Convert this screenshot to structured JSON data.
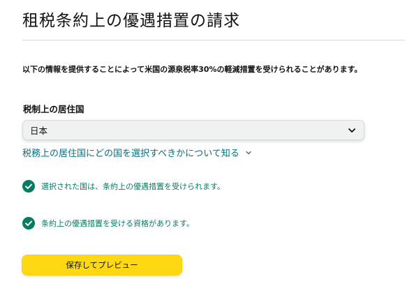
{
  "header": {
    "title": "租税条約上の優遇措置の請求"
  },
  "intro_text": "以下の情報を提供することによって米国の源泉税率30%の軽減措置を受けられることがあります。",
  "residence": {
    "label": "税制上の居住国",
    "selected_value": "日本",
    "dropdown_icon": "chevron-down-icon"
  },
  "learn_more": {
    "label": "税務上の居住国にどの国を選択すべきかについて知る",
    "icon": "chevron-down-icon"
  },
  "statuses": [
    {
      "text": "選択された国は、条約上の優遇措置を受けられます。",
      "icon": "check-circle-icon"
    },
    {
      "text": "条約上の優遇措置を受ける資格があります。",
      "icon": "check-circle-icon"
    }
  ],
  "actions": {
    "save_preview_label": "保存してプレビュー"
  },
  "colors": {
    "success": "#067d62",
    "link": "#007185",
    "primary_button": "#ffd814",
    "select_bg": "#f0f2f2"
  }
}
